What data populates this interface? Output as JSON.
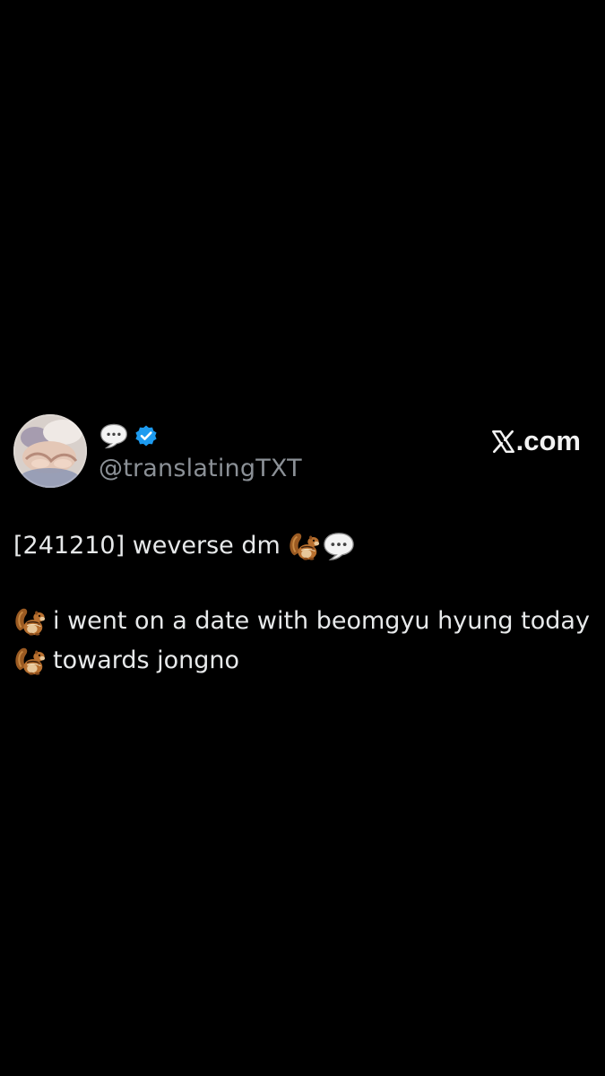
{
  "profile": {
    "handle": "@translatingTXT",
    "avatar_icon": "avatar-photo",
    "name_icon": "speech-balloon-icon",
    "verified_icon": "verified-badge-icon",
    "verified_color": "#1d9bf0"
  },
  "brand": {
    "label": ".com",
    "logo_icon": "x-logo-icon"
  },
  "tweet": {
    "line1_text": "[241210] weverse dm",
    "line1_emojis": [
      "chipmunk-emoji",
      "speech-balloon-emoji"
    ],
    "line2_text": "i went on a date with beomgyu hyung today",
    "line2_emoji": "chipmunk-emoji",
    "line3_text": "towards jongno",
    "line3_emoji": "chipmunk-emoji"
  },
  "colors": {
    "background": "#000000",
    "text": "#e7e9ea",
    "secondary_text": "#8b9096",
    "accent": "#1d9bf0"
  }
}
